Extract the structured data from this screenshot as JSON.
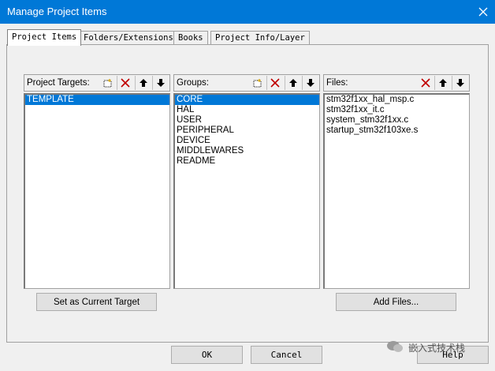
{
  "window": {
    "title": "Manage Project Items"
  },
  "tabs": [
    {
      "label": "Project Items"
    },
    {
      "label": "Folders/Extensions"
    },
    {
      "label": "Books"
    },
    {
      "label": "Project Info/Layer"
    }
  ],
  "targets": {
    "label": "Project Targets:",
    "items": [
      "TEMPLATE"
    ]
  },
  "groups": {
    "label": "Groups:",
    "items": [
      "CORE",
      "HAL",
      "USER",
      "PERIPHERAL",
      "DEVICE",
      "MIDDLEWARES",
      "README"
    ]
  },
  "files": {
    "label": "Files:",
    "items": [
      "stm32f1xx_hal_msp.c",
      "stm32f1xx_it.c",
      "system_stm32f1xx.c",
      "startup_stm32f103xe.s"
    ]
  },
  "buttons": {
    "set_target": "Set as Current Target",
    "add_files": "Add Files...",
    "ok": "OK",
    "cancel": "Cancel",
    "help": "Help"
  },
  "watermark": {
    "text": "嵌入式技术栈"
  },
  "colors": {
    "titlebar": "#0078d7",
    "selection": "#0078d7",
    "delete_icon": "#c00000"
  },
  "icons": [
    "close-icon",
    "new-item-icon",
    "delete-icon",
    "move-up-icon",
    "move-down-icon"
  ]
}
